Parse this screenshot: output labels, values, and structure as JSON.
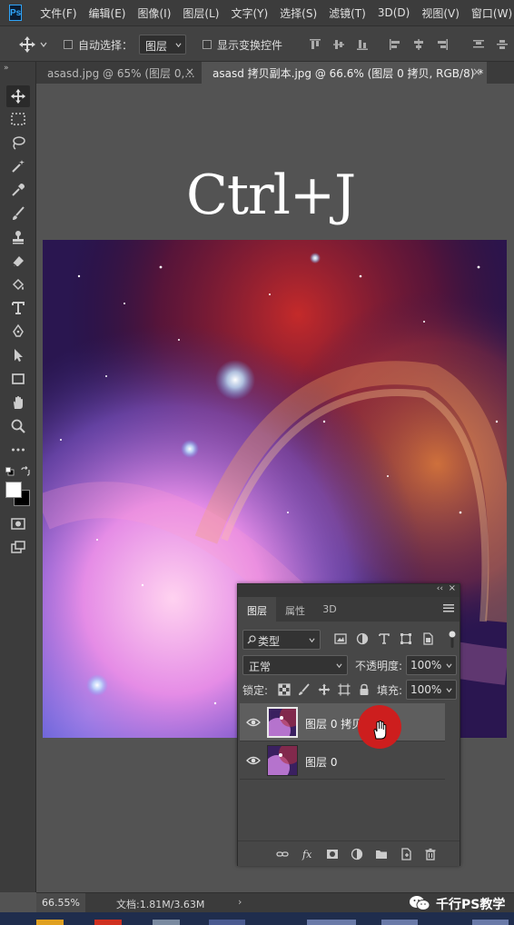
{
  "app": {
    "logo": "Ps",
    "menu": [
      "文件(F)",
      "编辑(E)",
      "图像(I)",
      "图层(L)",
      "文字(Y)",
      "选择(S)",
      "滤镜(T)",
      "3D(D)",
      "视图(V)",
      "窗口(W)"
    ]
  },
  "options": {
    "move_icon": "move-icon",
    "auto_select_label": "自动选择：",
    "auto_select_value": "图层",
    "auto_select_checked": false,
    "show_transform_label": "显示变换控件",
    "show_transform_checked": false,
    "align_icons": [
      "align-top-icon",
      "align-vcenter-icon",
      "align-bottom-icon",
      "align-left-icon",
      "align-hcenter-icon",
      "align-right-icon",
      "distribute-top-icon",
      "distribute-vcenter-icon"
    ]
  },
  "tabs": [
    {
      "label": "asasd.jpg @ 65% (图层 0,...",
      "close": "×",
      "active": false
    },
    {
      "label": "asasd 拷贝副本.jpg @ 66.6% (图层 0 拷贝, RGB/8) *",
      "close": "×",
      "active": true
    }
  ],
  "toolbar": {
    "collapse": "»",
    "tools": [
      "move-tool-icon",
      "marquee-tool-icon",
      "lasso-tool-icon",
      "magic-wand-icon",
      "eyedropper-icon",
      "brush-icon",
      "stamp-icon",
      "eraser-icon",
      "paint-bucket-icon",
      "type-tool-icon",
      "pen-tool-icon",
      "path-select-icon",
      "rectangle-tool-icon",
      "hand-tool-icon",
      "zoom-tool-icon",
      "more-tools-icon",
      "quick-mask-icon",
      "screen-mode-icon"
    ],
    "foreground_color": "#ffffff",
    "background_color": "#000000"
  },
  "canvas": {
    "overlay_text": "Ctrl+J"
  },
  "layers_panel": {
    "collapse": "‹‹",
    "close": "×",
    "tabs": [
      {
        "label": "图层",
        "active": true
      },
      {
        "label": "属性",
        "active": false
      },
      {
        "label": "3D",
        "active": false
      }
    ],
    "filter_value": "类型",
    "filter_icons": [
      "image-filter-icon",
      "adjustment-filter-icon",
      "type-filter-icon",
      "shape-filter-icon",
      "smart-object-filter-icon"
    ],
    "blend_mode": "正常",
    "opacity_label": "不透明度:",
    "opacity_value": "100%",
    "lock_label": "锁定:",
    "lock_icons": [
      "lock-transparency-icon",
      "lock-pixels-icon",
      "lock-position-icon",
      "lock-artboard-icon",
      "lock-all-icon"
    ],
    "fill_label": "填充:",
    "fill_value": "100%",
    "layers": [
      {
        "name": "图层 0 拷贝",
        "visible": true,
        "selected": true
      },
      {
        "name": "图层 0",
        "visible": true,
        "selected": false
      }
    ],
    "footer_icons": [
      "link-layers-icon",
      "fx-icon",
      "layer-mask-icon",
      "adjustment-layer-icon",
      "group-folder-icon",
      "new-layer-icon",
      "delete-layer-icon"
    ]
  },
  "status": {
    "zoom": "66.55%",
    "doc_info": "文档:1.81M/3.63M",
    "arrow": "›",
    "watermark": "千行PS教学"
  },
  "colors": {
    "highlight": "#cd1e1e",
    "ps_blue": "#31a8ff"
  }
}
